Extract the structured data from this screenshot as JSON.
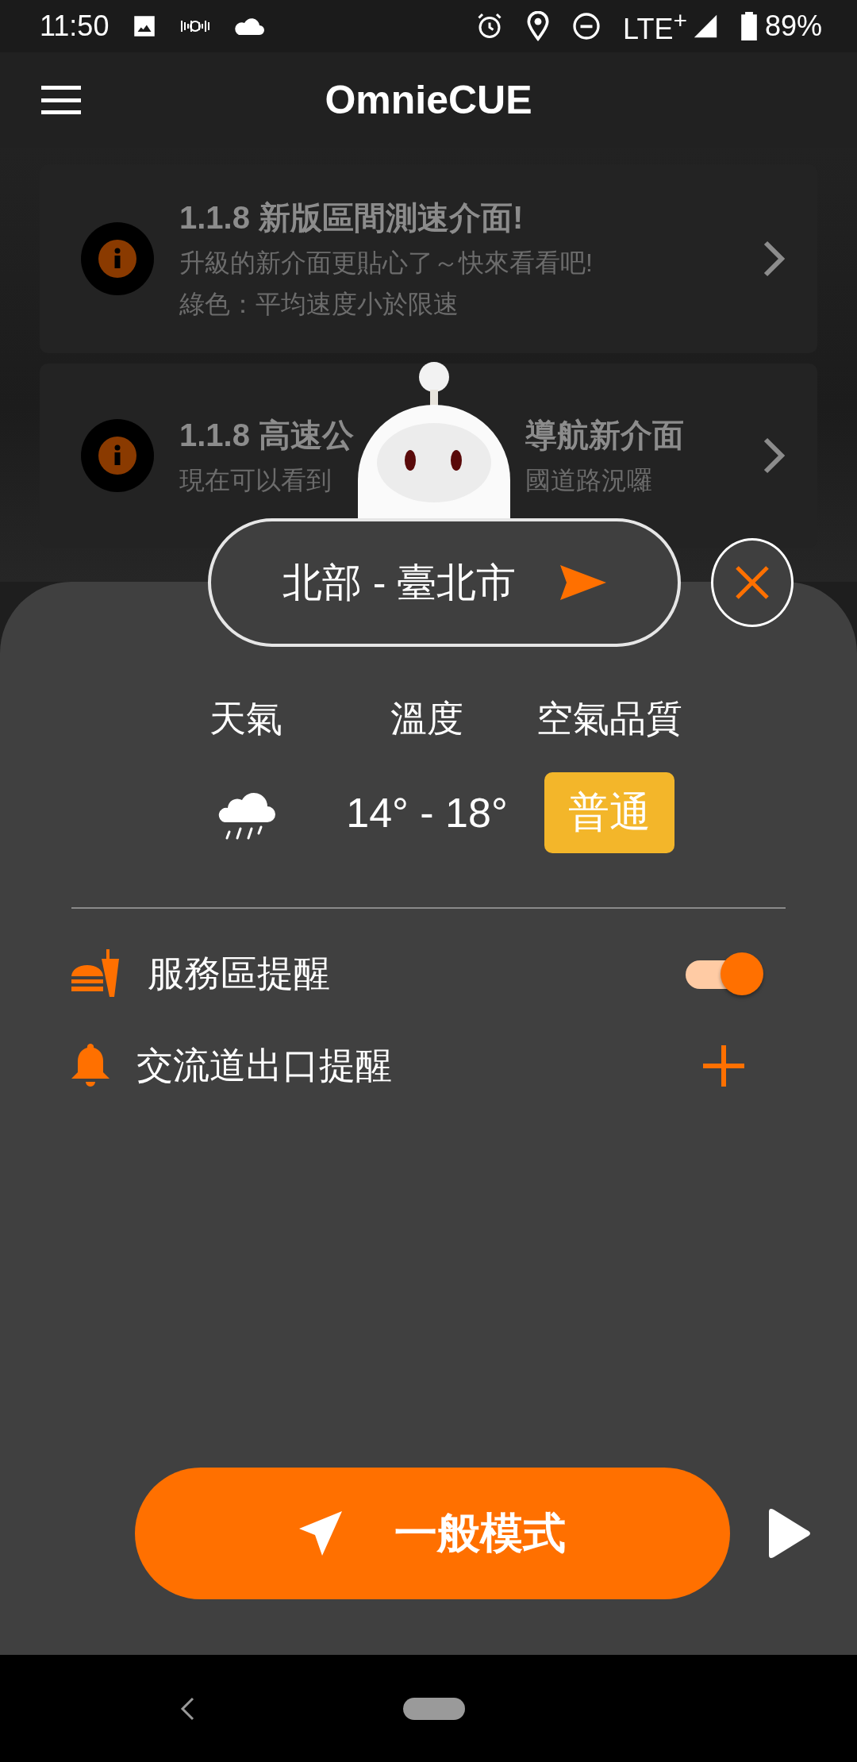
{
  "status_bar": {
    "time": "11:50",
    "network": "LTE$^{+}$",
    "battery": "89%"
  },
  "app_bar": {
    "title": "OmnieCUE"
  },
  "notices": [
    {
      "title": [
        "1.1.8 新版區間測速介面!"
      ],
      "lines": [
        [
          "升級的新介面更貼心了～快來看看吧!"
        ],
        [
          "綠色：平均速度小於限速"
        ]
      ]
    },
    {
      "title": [
        "1.1.8 高速公",
        "導航新介面"
      ],
      "lines": [
        [
          "現在可以看到",
          "國道路況囉"
        ]
      ]
    }
  ],
  "location": {
    "label": "北部 - 臺北市"
  },
  "weather": [
    {
      "kind": "icon",
      "label": "天氣"
    },
    {
      "kind": "text",
      "label": "溫度",
      "value": "14° - 18°"
    },
    {
      "kind": "badge",
      "label": "空氣品質",
      "value": "普通"
    }
  ],
  "reminders": [
    {
      "kind": "toggle",
      "label": "服務區提醒",
      "on": true
    },
    {
      "kind": "add",
      "label": "交流道出口提醒"
    }
  ],
  "mode_button": {
    "label": "一般模式"
  }
}
